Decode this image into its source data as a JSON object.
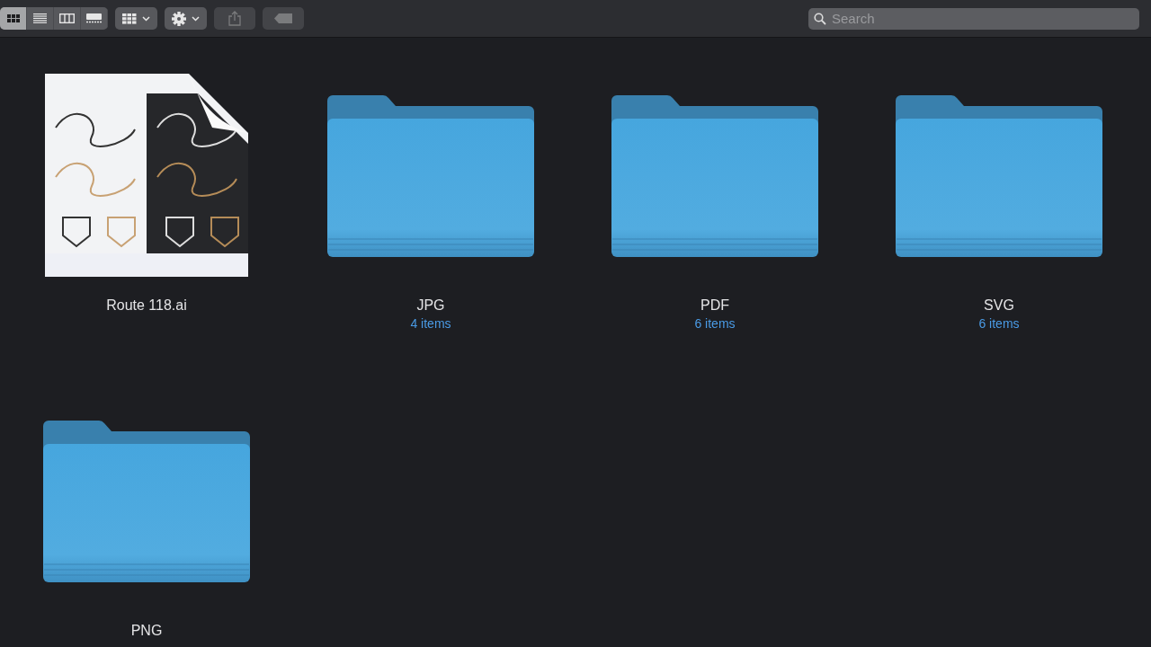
{
  "toolbar": {
    "view_modes": [
      {
        "kind": "icons",
        "selected": true
      },
      {
        "kind": "list",
        "selected": false
      },
      {
        "kind": "columns",
        "selected": false
      },
      {
        "kind": "gallery",
        "selected": false
      }
    ],
    "group_button": {
      "disabled": false
    },
    "action_button": {
      "disabled": false
    },
    "share_button": {
      "disabled": true
    },
    "tag_button": {
      "disabled": true
    },
    "search": {
      "placeholder": "Search"
    }
  },
  "items": [
    {
      "kind": "document",
      "name": "Route 118.ai"
    },
    {
      "kind": "folder",
      "name": "JPG",
      "count": "4 items"
    },
    {
      "kind": "folder",
      "name": "PDF",
      "count": "6 items"
    },
    {
      "kind": "folder",
      "name": "SVG",
      "count": "6 items"
    },
    {
      "kind": "folder",
      "name": "PNG"
    }
  ]
}
